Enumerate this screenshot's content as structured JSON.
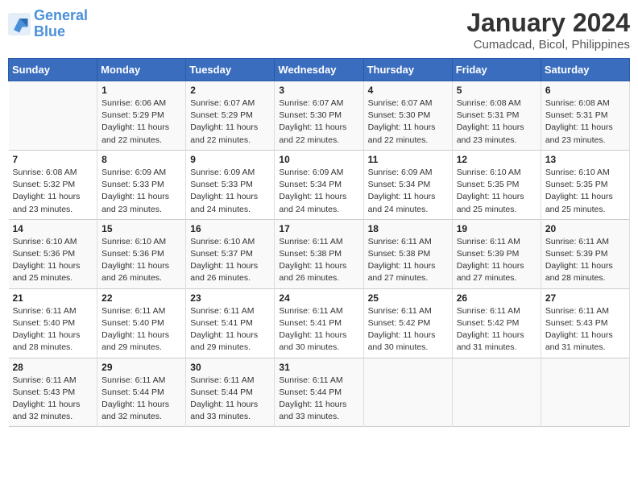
{
  "logo": {
    "text_general": "General",
    "text_blue": "Blue"
  },
  "title": "January 2024",
  "subtitle": "Cumadcad, Bicol, Philippines",
  "days_of_week": [
    "Sunday",
    "Monday",
    "Tuesday",
    "Wednesday",
    "Thursday",
    "Friday",
    "Saturday"
  ],
  "weeks": [
    [
      {
        "num": "",
        "info": ""
      },
      {
        "num": "1",
        "info": "Sunrise: 6:06 AM\nSunset: 5:29 PM\nDaylight: 11 hours\nand 22 minutes."
      },
      {
        "num": "2",
        "info": "Sunrise: 6:07 AM\nSunset: 5:29 PM\nDaylight: 11 hours\nand 22 minutes."
      },
      {
        "num": "3",
        "info": "Sunrise: 6:07 AM\nSunset: 5:30 PM\nDaylight: 11 hours\nand 22 minutes."
      },
      {
        "num": "4",
        "info": "Sunrise: 6:07 AM\nSunset: 5:30 PM\nDaylight: 11 hours\nand 22 minutes."
      },
      {
        "num": "5",
        "info": "Sunrise: 6:08 AM\nSunset: 5:31 PM\nDaylight: 11 hours\nand 23 minutes."
      },
      {
        "num": "6",
        "info": "Sunrise: 6:08 AM\nSunset: 5:31 PM\nDaylight: 11 hours\nand 23 minutes."
      }
    ],
    [
      {
        "num": "7",
        "info": "Sunrise: 6:08 AM\nSunset: 5:32 PM\nDaylight: 11 hours\nand 23 minutes."
      },
      {
        "num": "8",
        "info": "Sunrise: 6:09 AM\nSunset: 5:33 PM\nDaylight: 11 hours\nand 23 minutes."
      },
      {
        "num": "9",
        "info": "Sunrise: 6:09 AM\nSunset: 5:33 PM\nDaylight: 11 hours\nand 24 minutes."
      },
      {
        "num": "10",
        "info": "Sunrise: 6:09 AM\nSunset: 5:34 PM\nDaylight: 11 hours\nand 24 minutes."
      },
      {
        "num": "11",
        "info": "Sunrise: 6:09 AM\nSunset: 5:34 PM\nDaylight: 11 hours\nand 24 minutes."
      },
      {
        "num": "12",
        "info": "Sunrise: 6:10 AM\nSunset: 5:35 PM\nDaylight: 11 hours\nand 25 minutes."
      },
      {
        "num": "13",
        "info": "Sunrise: 6:10 AM\nSunset: 5:35 PM\nDaylight: 11 hours\nand 25 minutes."
      }
    ],
    [
      {
        "num": "14",
        "info": "Sunrise: 6:10 AM\nSunset: 5:36 PM\nDaylight: 11 hours\nand 25 minutes."
      },
      {
        "num": "15",
        "info": "Sunrise: 6:10 AM\nSunset: 5:36 PM\nDaylight: 11 hours\nand 26 minutes."
      },
      {
        "num": "16",
        "info": "Sunrise: 6:10 AM\nSunset: 5:37 PM\nDaylight: 11 hours\nand 26 minutes."
      },
      {
        "num": "17",
        "info": "Sunrise: 6:11 AM\nSunset: 5:38 PM\nDaylight: 11 hours\nand 26 minutes."
      },
      {
        "num": "18",
        "info": "Sunrise: 6:11 AM\nSunset: 5:38 PM\nDaylight: 11 hours\nand 27 minutes."
      },
      {
        "num": "19",
        "info": "Sunrise: 6:11 AM\nSunset: 5:39 PM\nDaylight: 11 hours\nand 27 minutes."
      },
      {
        "num": "20",
        "info": "Sunrise: 6:11 AM\nSunset: 5:39 PM\nDaylight: 11 hours\nand 28 minutes."
      }
    ],
    [
      {
        "num": "21",
        "info": "Sunrise: 6:11 AM\nSunset: 5:40 PM\nDaylight: 11 hours\nand 28 minutes."
      },
      {
        "num": "22",
        "info": "Sunrise: 6:11 AM\nSunset: 5:40 PM\nDaylight: 11 hours\nand 29 minutes."
      },
      {
        "num": "23",
        "info": "Sunrise: 6:11 AM\nSunset: 5:41 PM\nDaylight: 11 hours\nand 29 minutes."
      },
      {
        "num": "24",
        "info": "Sunrise: 6:11 AM\nSunset: 5:41 PM\nDaylight: 11 hours\nand 30 minutes."
      },
      {
        "num": "25",
        "info": "Sunrise: 6:11 AM\nSunset: 5:42 PM\nDaylight: 11 hours\nand 30 minutes."
      },
      {
        "num": "26",
        "info": "Sunrise: 6:11 AM\nSunset: 5:42 PM\nDaylight: 11 hours\nand 31 minutes."
      },
      {
        "num": "27",
        "info": "Sunrise: 6:11 AM\nSunset: 5:43 PM\nDaylight: 11 hours\nand 31 minutes."
      }
    ],
    [
      {
        "num": "28",
        "info": "Sunrise: 6:11 AM\nSunset: 5:43 PM\nDaylight: 11 hours\nand 32 minutes."
      },
      {
        "num": "29",
        "info": "Sunrise: 6:11 AM\nSunset: 5:44 PM\nDaylight: 11 hours\nand 32 minutes."
      },
      {
        "num": "30",
        "info": "Sunrise: 6:11 AM\nSunset: 5:44 PM\nDaylight: 11 hours\nand 33 minutes."
      },
      {
        "num": "31",
        "info": "Sunrise: 6:11 AM\nSunset: 5:44 PM\nDaylight: 11 hours\nand 33 minutes."
      },
      {
        "num": "",
        "info": ""
      },
      {
        "num": "",
        "info": ""
      },
      {
        "num": "",
        "info": ""
      }
    ]
  ]
}
